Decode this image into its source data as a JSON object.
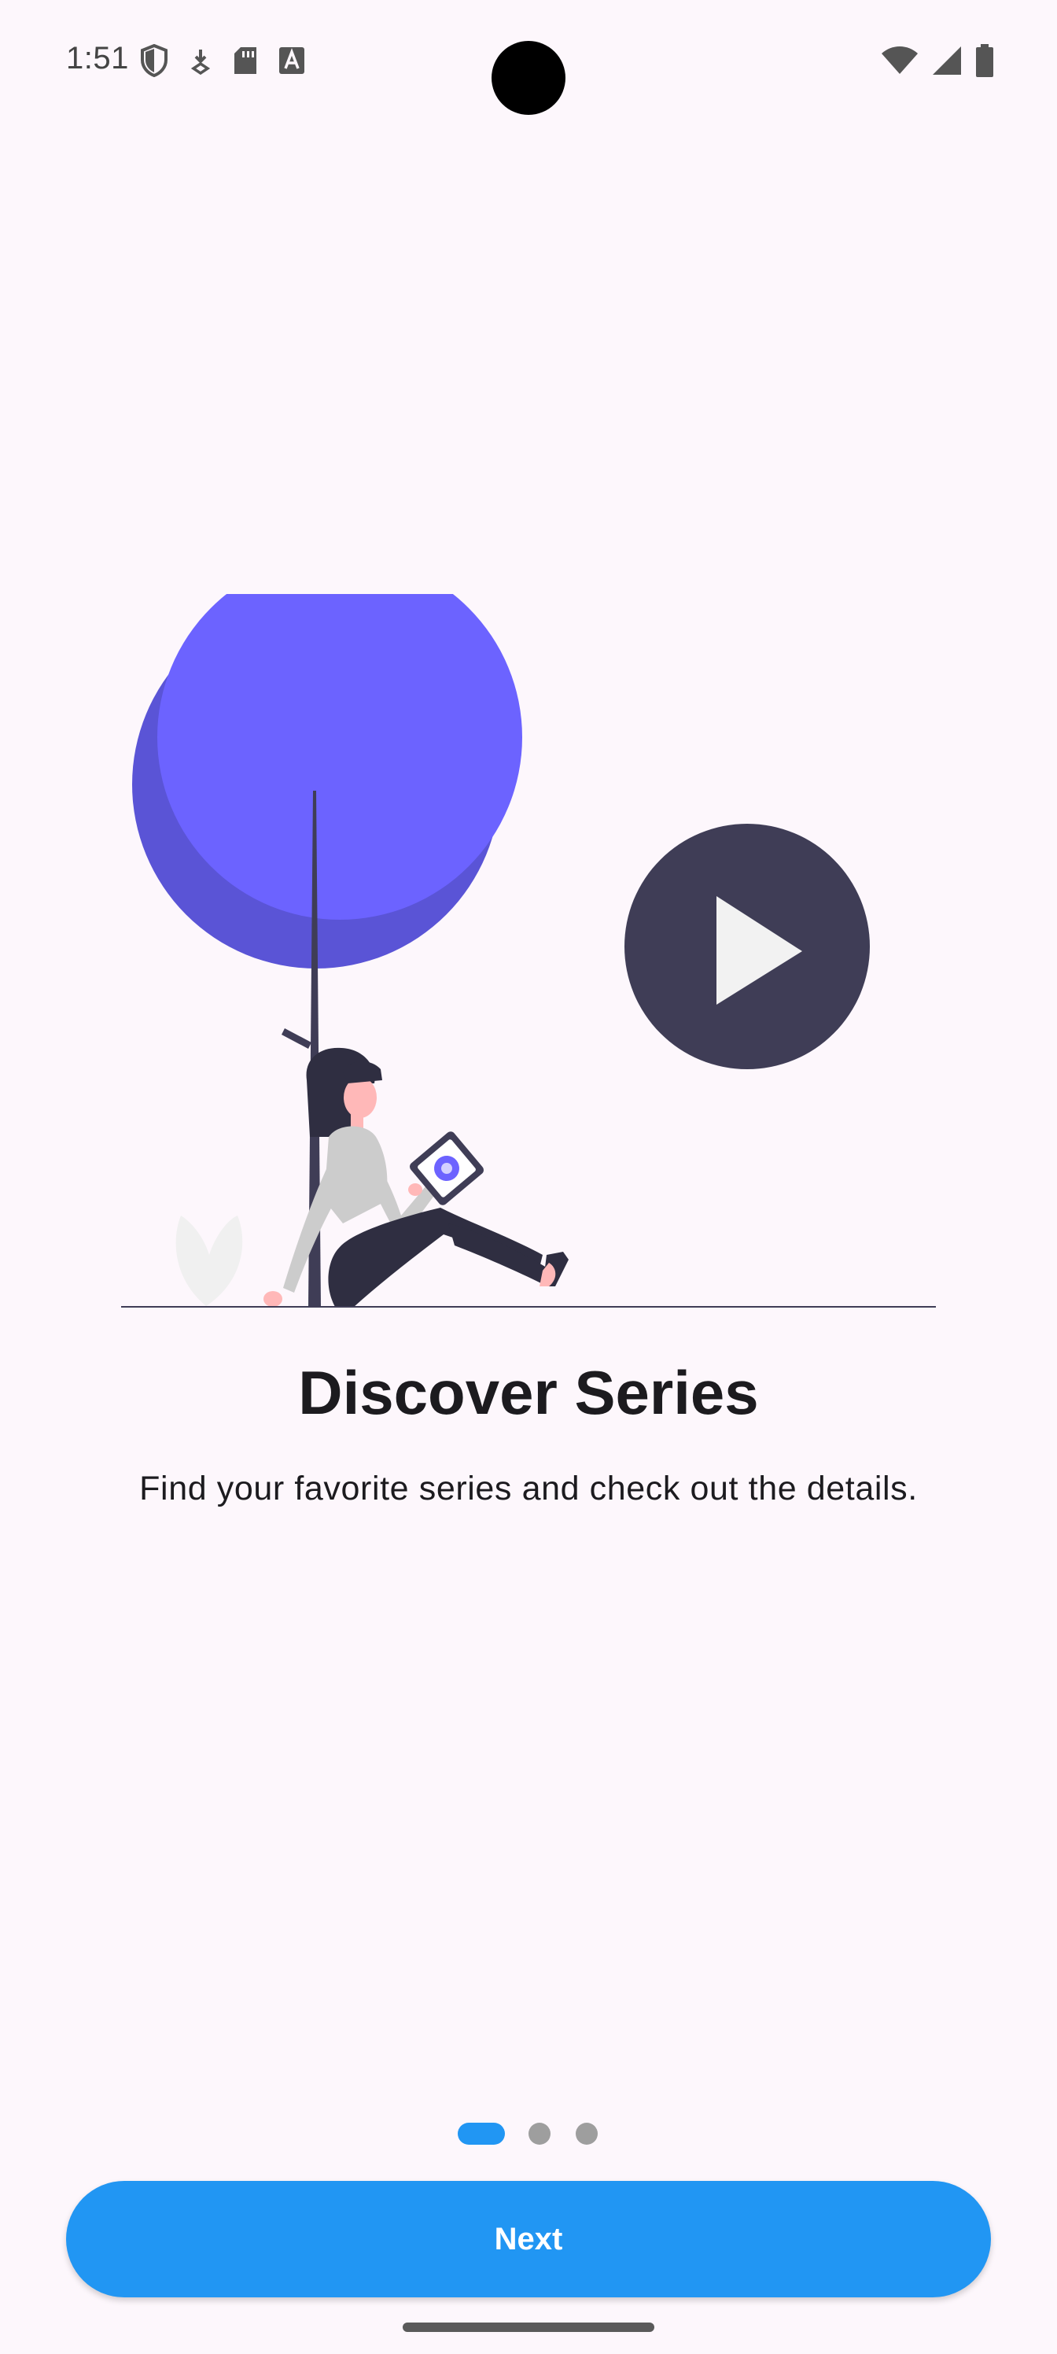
{
  "status_bar": {
    "time": "1:51",
    "left_icons": [
      "shield-icon",
      "download-icon",
      "sd-card-icon",
      "font-a-icon"
    ],
    "right_icons": [
      "wifi-icon",
      "cellular-signal-icon",
      "battery-icon"
    ]
  },
  "onboarding": {
    "title": "Discover Series",
    "subtitle": "Find your favorite series and check out the details.",
    "current_page": 1,
    "total_pages": 3,
    "next_label": "Next"
  },
  "colors": {
    "accent": "#2196F3",
    "background": "#FDF7FC",
    "illustration_primary": "#6C63FF",
    "illustration_dark": "#3F3D56"
  }
}
